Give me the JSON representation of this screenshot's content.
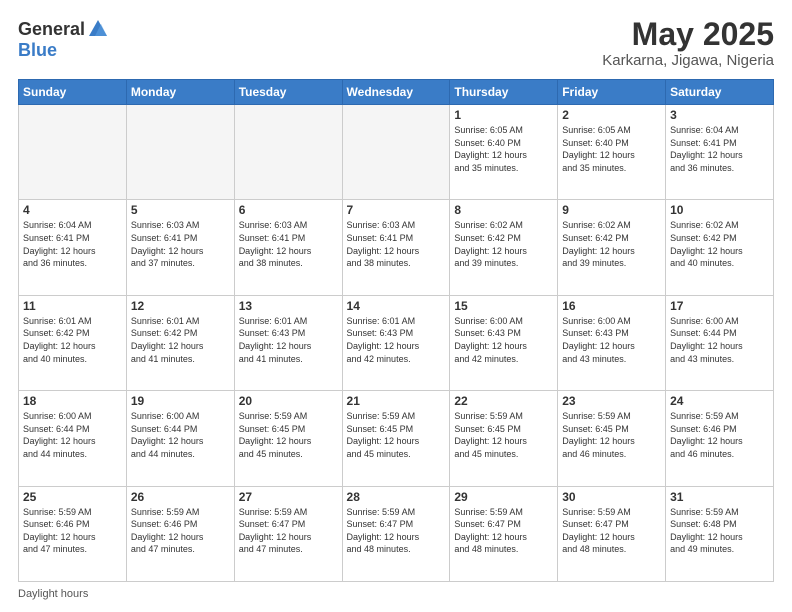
{
  "logo": {
    "general": "General",
    "blue": "Blue"
  },
  "title": "May 2025",
  "location": "Karkarna, Jigawa, Nigeria",
  "days_of_week": [
    "Sunday",
    "Monday",
    "Tuesday",
    "Wednesday",
    "Thursday",
    "Friday",
    "Saturday"
  ],
  "footer_text": "Daylight hours",
  "weeks": [
    [
      {
        "day": "",
        "info": ""
      },
      {
        "day": "",
        "info": ""
      },
      {
        "day": "",
        "info": ""
      },
      {
        "day": "",
        "info": ""
      },
      {
        "day": "1",
        "info": "Sunrise: 6:05 AM\nSunset: 6:40 PM\nDaylight: 12 hours\nand 35 minutes."
      },
      {
        "day": "2",
        "info": "Sunrise: 6:05 AM\nSunset: 6:40 PM\nDaylight: 12 hours\nand 35 minutes."
      },
      {
        "day": "3",
        "info": "Sunrise: 6:04 AM\nSunset: 6:41 PM\nDaylight: 12 hours\nand 36 minutes."
      }
    ],
    [
      {
        "day": "4",
        "info": "Sunrise: 6:04 AM\nSunset: 6:41 PM\nDaylight: 12 hours\nand 36 minutes."
      },
      {
        "day": "5",
        "info": "Sunrise: 6:03 AM\nSunset: 6:41 PM\nDaylight: 12 hours\nand 37 minutes."
      },
      {
        "day": "6",
        "info": "Sunrise: 6:03 AM\nSunset: 6:41 PM\nDaylight: 12 hours\nand 38 minutes."
      },
      {
        "day": "7",
        "info": "Sunrise: 6:03 AM\nSunset: 6:41 PM\nDaylight: 12 hours\nand 38 minutes."
      },
      {
        "day": "8",
        "info": "Sunrise: 6:02 AM\nSunset: 6:42 PM\nDaylight: 12 hours\nand 39 minutes."
      },
      {
        "day": "9",
        "info": "Sunrise: 6:02 AM\nSunset: 6:42 PM\nDaylight: 12 hours\nand 39 minutes."
      },
      {
        "day": "10",
        "info": "Sunrise: 6:02 AM\nSunset: 6:42 PM\nDaylight: 12 hours\nand 40 minutes."
      }
    ],
    [
      {
        "day": "11",
        "info": "Sunrise: 6:01 AM\nSunset: 6:42 PM\nDaylight: 12 hours\nand 40 minutes."
      },
      {
        "day": "12",
        "info": "Sunrise: 6:01 AM\nSunset: 6:42 PM\nDaylight: 12 hours\nand 41 minutes."
      },
      {
        "day": "13",
        "info": "Sunrise: 6:01 AM\nSunset: 6:43 PM\nDaylight: 12 hours\nand 41 minutes."
      },
      {
        "day": "14",
        "info": "Sunrise: 6:01 AM\nSunset: 6:43 PM\nDaylight: 12 hours\nand 42 minutes."
      },
      {
        "day": "15",
        "info": "Sunrise: 6:00 AM\nSunset: 6:43 PM\nDaylight: 12 hours\nand 42 minutes."
      },
      {
        "day": "16",
        "info": "Sunrise: 6:00 AM\nSunset: 6:43 PM\nDaylight: 12 hours\nand 43 minutes."
      },
      {
        "day": "17",
        "info": "Sunrise: 6:00 AM\nSunset: 6:44 PM\nDaylight: 12 hours\nand 43 minutes."
      }
    ],
    [
      {
        "day": "18",
        "info": "Sunrise: 6:00 AM\nSunset: 6:44 PM\nDaylight: 12 hours\nand 44 minutes."
      },
      {
        "day": "19",
        "info": "Sunrise: 6:00 AM\nSunset: 6:44 PM\nDaylight: 12 hours\nand 44 minutes."
      },
      {
        "day": "20",
        "info": "Sunrise: 5:59 AM\nSunset: 6:45 PM\nDaylight: 12 hours\nand 45 minutes."
      },
      {
        "day": "21",
        "info": "Sunrise: 5:59 AM\nSunset: 6:45 PM\nDaylight: 12 hours\nand 45 minutes."
      },
      {
        "day": "22",
        "info": "Sunrise: 5:59 AM\nSunset: 6:45 PM\nDaylight: 12 hours\nand 45 minutes."
      },
      {
        "day": "23",
        "info": "Sunrise: 5:59 AM\nSunset: 6:45 PM\nDaylight: 12 hours\nand 46 minutes."
      },
      {
        "day": "24",
        "info": "Sunrise: 5:59 AM\nSunset: 6:46 PM\nDaylight: 12 hours\nand 46 minutes."
      }
    ],
    [
      {
        "day": "25",
        "info": "Sunrise: 5:59 AM\nSunset: 6:46 PM\nDaylight: 12 hours\nand 47 minutes."
      },
      {
        "day": "26",
        "info": "Sunrise: 5:59 AM\nSunset: 6:46 PM\nDaylight: 12 hours\nand 47 minutes."
      },
      {
        "day": "27",
        "info": "Sunrise: 5:59 AM\nSunset: 6:47 PM\nDaylight: 12 hours\nand 47 minutes."
      },
      {
        "day": "28",
        "info": "Sunrise: 5:59 AM\nSunset: 6:47 PM\nDaylight: 12 hours\nand 48 minutes."
      },
      {
        "day": "29",
        "info": "Sunrise: 5:59 AM\nSunset: 6:47 PM\nDaylight: 12 hours\nand 48 minutes."
      },
      {
        "day": "30",
        "info": "Sunrise: 5:59 AM\nSunset: 6:47 PM\nDaylight: 12 hours\nand 48 minutes."
      },
      {
        "day": "31",
        "info": "Sunrise: 5:59 AM\nSunset: 6:48 PM\nDaylight: 12 hours\nand 49 minutes."
      }
    ]
  ]
}
